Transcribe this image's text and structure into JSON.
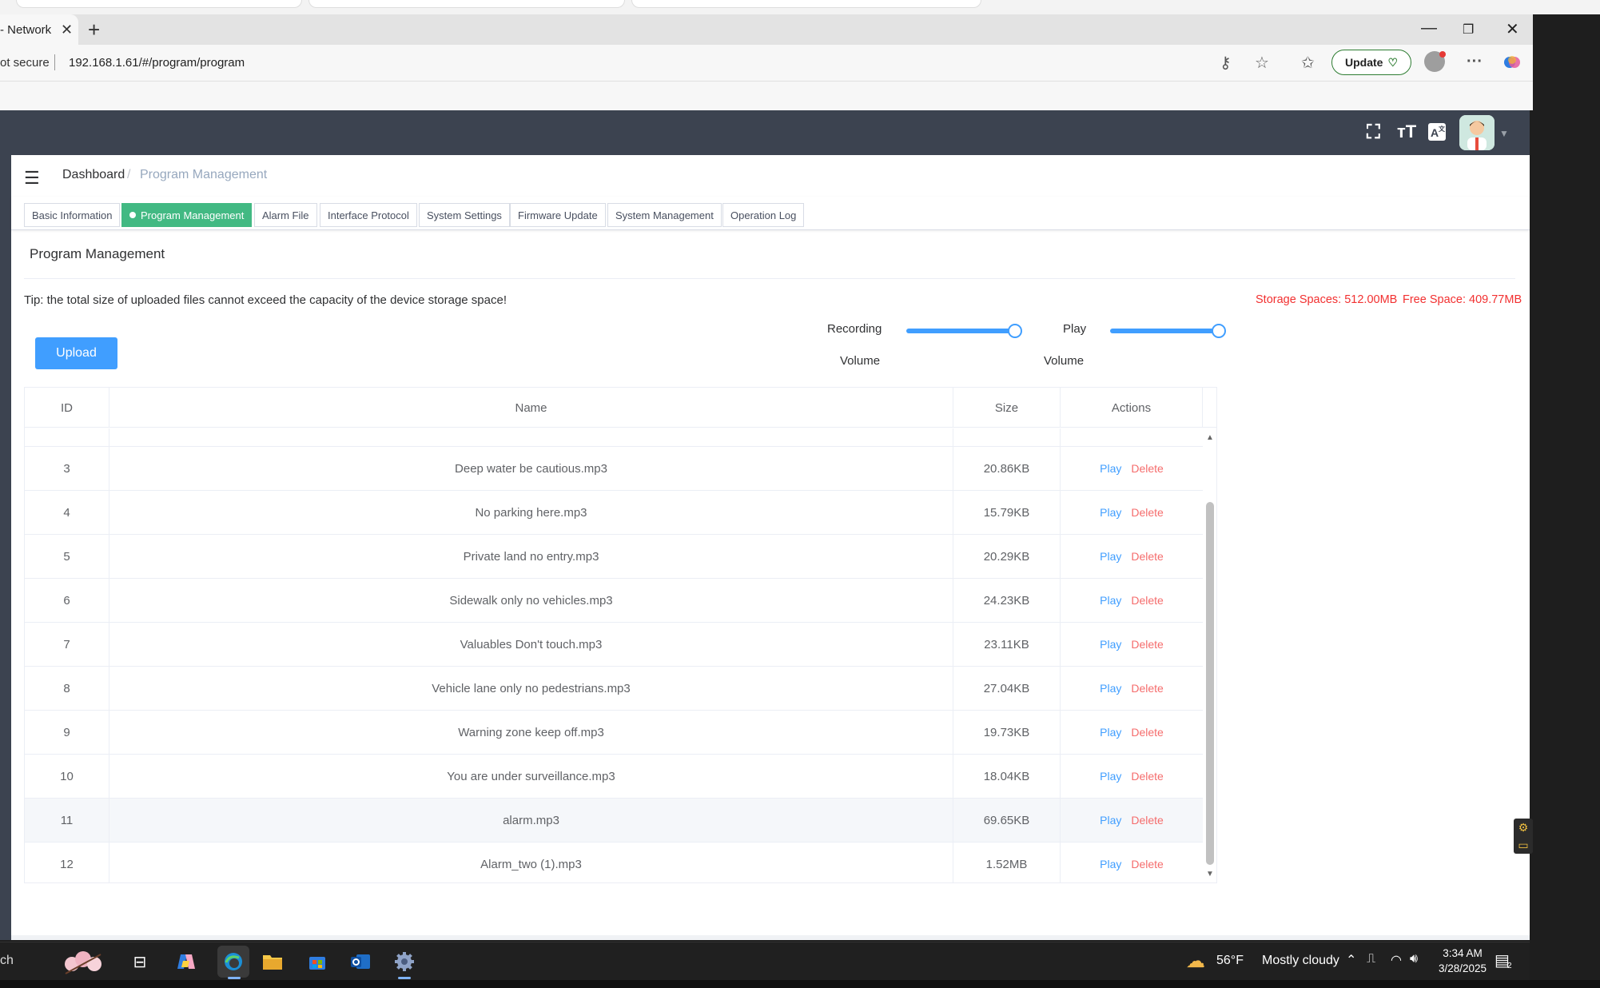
{
  "browser": {
    "tab_title": "- Network",
    "tab_close": "✕",
    "new_tab": "+",
    "security": "ot secure",
    "url": "192.168.1.61/#/program/program",
    "update_label": "Update",
    "minimize": "—",
    "restore": "❐",
    "close": "✕",
    "more": "···"
  },
  "header": {
    "fullscreen_icon": "fullscreen-icon",
    "fontsize_icon": "font-size-icon",
    "translate_icon": "translate-icon",
    "avatar_caret": "▼"
  },
  "breadcrumb": {
    "home": "Dashboard",
    "separator": "/",
    "current": "Program Management"
  },
  "tags": [
    {
      "label": "Basic Information",
      "active": false
    },
    {
      "label": "Program Management",
      "active": true
    },
    {
      "label": "Alarm File",
      "active": false
    },
    {
      "label": "Interface Protocol",
      "active": false
    },
    {
      "label": "System Settings",
      "active": false
    },
    {
      "label": "Firmware Update",
      "active": false
    },
    {
      "label": "System Management",
      "active": false
    },
    {
      "label": "Operation Log",
      "active": false
    }
  ],
  "page": {
    "title": "Program Management",
    "tip": "Tip: the total size of uploaded files cannot exceed the capacity of the device storage space!",
    "storage": "Storage Spaces: 512.00MB",
    "free_space": "Free Space: 409.77MB",
    "upload_label": "Upload"
  },
  "volume": {
    "recording_label_1": "Recording",
    "recording_label_2": "Volume",
    "recording_level": 1.0,
    "play_label_1": "Play",
    "play_label_2": "Volume",
    "play_level": 1.0
  },
  "table": {
    "columns": [
      "ID",
      "Name",
      "Size",
      "Actions"
    ],
    "play_label": "Play",
    "delete_label": "Delete",
    "rows": [
      {
        "id": "3",
        "name": "Deep water be cautious.mp3",
        "size": "20.86KB"
      },
      {
        "id": "4",
        "name": "No parking here.mp3",
        "size": "15.79KB"
      },
      {
        "id": "5",
        "name": "Private land no entry.mp3",
        "size": "20.29KB"
      },
      {
        "id": "6",
        "name": "Sidewalk only no vehicles.mp3",
        "size": "24.23KB"
      },
      {
        "id": "7",
        "name": "Valuables Don't touch.mp3",
        "size": "23.11KB"
      },
      {
        "id": "8",
        "name": "Vehicle lane only no pedestrians.mp3",
        "size": "27.04KB"
      },
      {
        "id": "9",
        "name": "Warning zone keep off.mp3",
        "size": "19.73KB"
      },
      {
        "id": "10",
        "name": "You are under surveillance.mp3",
        "size": "18.04KB"
      },
      {
        "id": "11",
        "name": "alarm.mp3",
        "size": "69.65KB"
      },
      {
        "id": "12",
        "name": "Alarm_two (1).mp3",
        "size": "1.52MB"
      }
    ]
  },
  "taskbar": {
    "search_fragment": "ch",
    "temperature": "56°F",
    "condition": "Mostly cloudy",
    "time": "3:34 AM",
    "date": "3/28/2025",
    "notification_count": "2"
  },
  "colors": {
    "accent": "#409eff",
    "active_tag": "#42b983",
    "danger": "#f56c6c",
    "header_bg": "#3c4350",
    "storage_red": "#f23030"
  }
}
